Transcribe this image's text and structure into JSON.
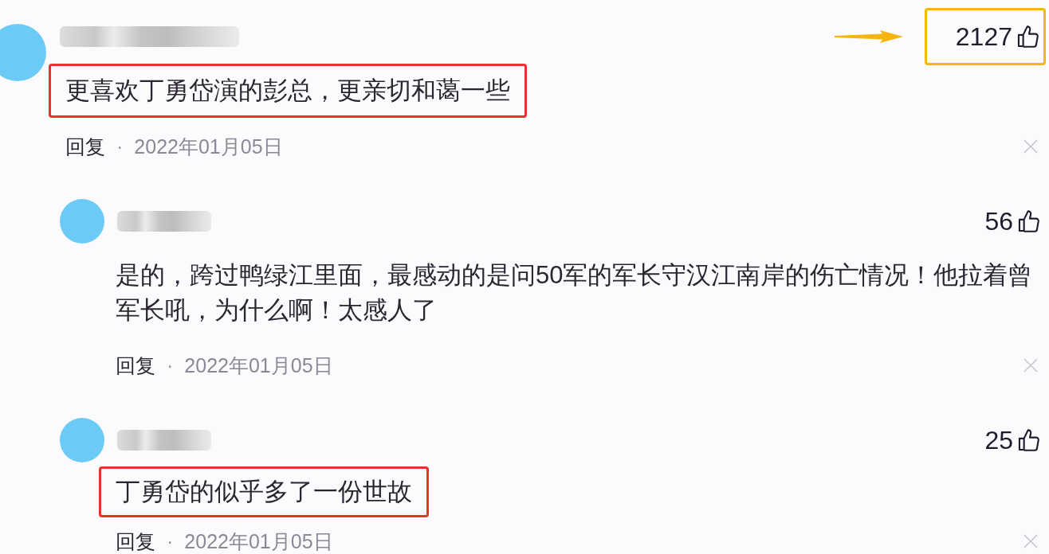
{
  "comments": [
    {
      "likes": "2127",
      "likes_highlighted": true,
      "text": "更喜欢丁勇岱演的彭总，更亲切和蔼一些",
      "text_highlighted": true,
      "reply_label": "回复",
      "separator": "·",
      "date": "2022年01月05日",
      "children": [
        {
          "likes": "56",
          "likes_highlighted": false,
          "text": "是的，跨过鸭绿江里面，最感动的是问50军的军长守汉江南岸的伤亡情况！他拉着曾军长吼，为什么啊！太感人了",
          "text_highlighted": false,
          "reply_label": "回复",
          "separator": "·",
          "date": "2022年01月05日"
        },
        {
          "likes": "25",
          "likes_highlighted": false,
          "text": "丁勇岱的似乎多了一份世故",
          "text_highlighted": true,
          "reply_label": "回复",
          "separator": "·",
          "date": "2022年01月05日"
        }
      ]
    }
  ]
}
